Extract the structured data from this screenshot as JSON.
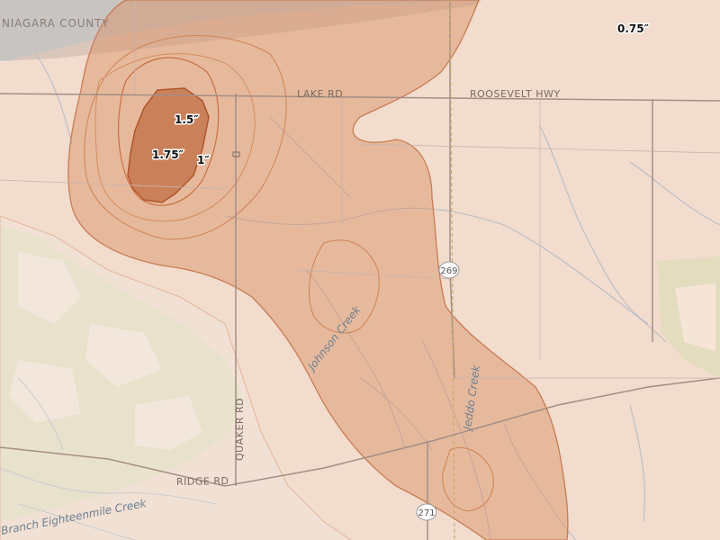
{
  "map": {
    "region_label": "NIAGARA COUNTY",
    "roads": {
      "lake_rd": "LAKE RD",
      "roosevelt_hwy": "ROOSEVELT HWY",
      "quaker_rd": "QUAKER RD",
      "ridge_rd": "RIDGE RD"
    },
    "route_shields": [
      "269",
      "271"
    ],
    "waterways": [
      "Johnson Creek",
      "Jeddo Creek",
      "Branch Eighteenmile Creek"
    ],
    "contours": [
      {
        "value": 0.75,
        "label": "0.75″"
      },
      {
        "value": 1.0,
        "label": "1″"
      },
      {
        "value": 1.5,
        "label": "1.5″"
      },
      {
        "value": 1.75,
        "label": "1.75″"
      }
    ],
    "colors": {
      "base": "#f1ece2",
      "woodland": "#d9ebc9",
      "contour_0_75": "#f2c9b4",
      "contour_1": "#d98d62",
      "contour_1_5": "#c8703f",
      "contour_1_75": "#b85c2f",
      "water": "#6b9ccc"
    }
  }
}
